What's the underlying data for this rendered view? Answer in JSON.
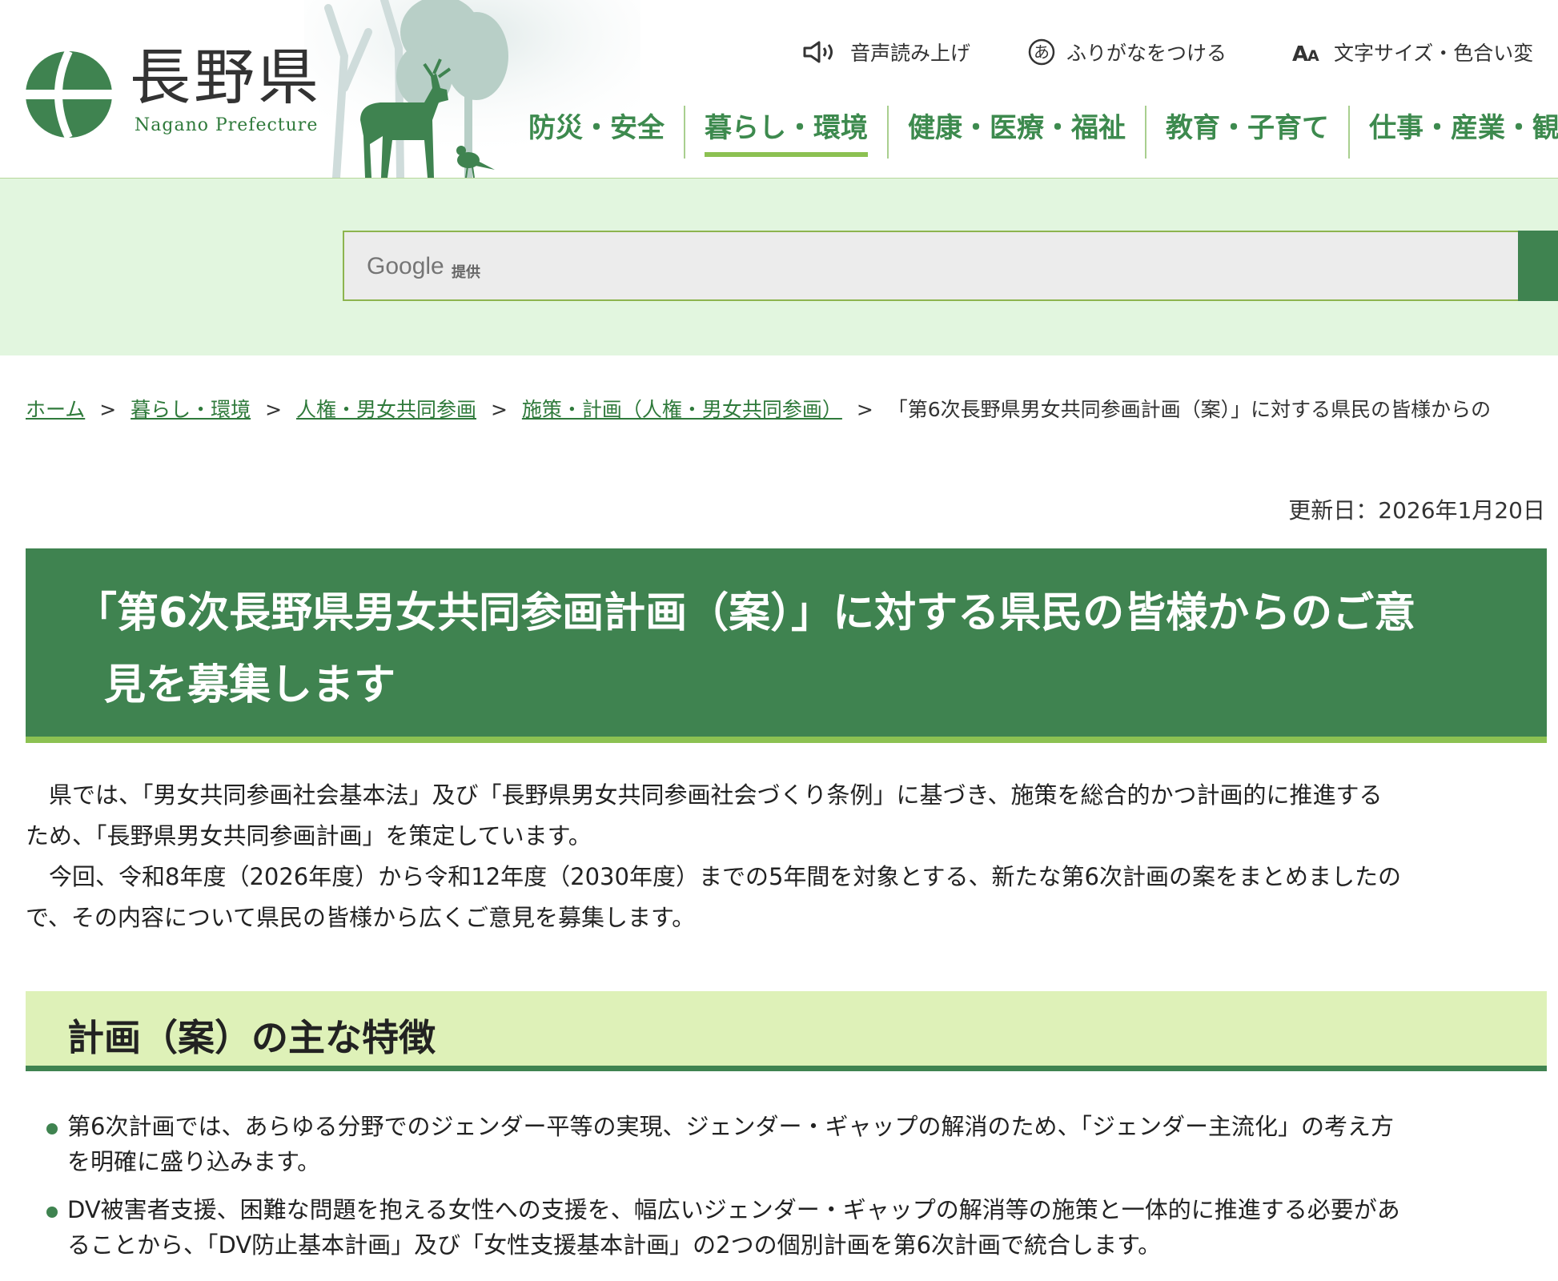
{
  "header": {
    "logo_jp": "長野県",
    "logo_en": "Nagano Prefecture",
    "utility": {
      "speech": "音声読み上げ",
      "furigana": "ふりがなをつける",
      "text_size": "文字サイズ・色合い変"
    },
    "nav": [
      "防災・安全",
      "暮らし・環境",
      "健康・医療・福祉",
      "教育・子育て",
      "仕事・産業・観"
    ],
    "nav_active_index": 1
  },
  "search": {
    "google_label": "Google",
    "provided_label": "提供",
    "placeholder": ""
  },
  "breadcrumb": {
    "items": [
      "ホーム",
      "暮らし・環境",
      "人権・男女共同参画",
      "施策・計画（人権・男女共同参画）"
    ],
    "current": "「第6次長野県男女共同参画計画（案）」に対する県民の皆様からの",
    "separator": ">"
  },
  "updated": "更新日：2026年1月20日",
  "title": {
    "line1": "「第6次長野県男女共同参画計画（案）」に対する県民の皆様からのご意",
    "line2": "見を募集します"
  },
  "intro": {
    "line1": "　県では、「男女共同参画社会基本法」及び「長野県男女共同参画社会づくり条例」に基づき、施策を総合的かつ計画的に推進する",
    "line2": "ため、「長野県男女共同参画計画」を策定しています。",
    "line3": "　今回、令和8年度（2026年度）から令和12年度（2030年度）までの5年間を対象とする、新たな第6次計画の案をまとめましたの",
    "line4": "で、その内容について県民の皆様から広くご意見を募集します。"
  },
  "section": {
    "heading": "計画（案）の主な特徴",
    "bullets": [
      {
        "line1": "第6次計画では、あらゆる分野でのジェンダー平等の実現、ジェンダー・ギャップの解消のため、「ジェンダー主流化」の考え方",
        "line2": "を明確に盛り込みます。"
      },
      {
        "line1": "DV被害者支援、困難な問題を抱える女性への支援を、幅広いジェンダー・ギャップの解消等の施策と一体的に推進する必要があ",
        "line2": "ることから、「DV防止基本計画」及び「女性支援基本計画」の2つの個別計画を第6次計画で統合します。"
      }
    ]
  },
  "colors": {
    "brand_green": "#3f8350",
    "accent_lime": "#8cc152",
    "search_band": "#e2f6df",
    "section_bg": "#def1b8"
  }
}
